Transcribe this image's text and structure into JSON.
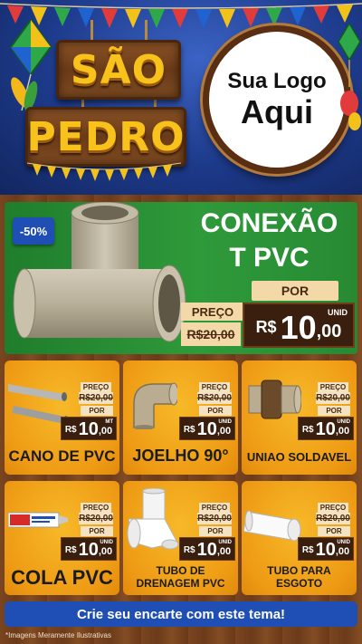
{
  "header": {
    "title_line1": "SÃO",
    "title_line2": "PEDRO",
    "logo_line1": "Sua Logo",
    "logo_line2": "Aqui"
  },
  "hero": {
    "discount": "-50%",
    "title_line1": "CONEXÃO",
    "title_line2": "T PVC",
    "por_label": "POR",
    "preco_label": "PREÇO",
    "old_price": "R$20,00",
    "currency": "R$",
    "price_int": "10",
    "price_dec": ",00",
    "unit": "UNID"
  },
  "products": [
    {
      "name": "CANO DE PVC",
      "preco_label": "PREÇO",
      "old_price": "R$20,00",
      "por_label": "POR",
      "currency": "R$",
      "price_int": "10",
      "price_dec": ",00",
      "unit": "MT"
    },
    {
      "name": "JOELHO 90°",
      "preco_label": "PREÇO",
      "old_price": "R$20,00",
      "por_label": "POR",
      "currency": "R$",
      "price_int": "10",
      "price_dec": ",00",
      "unit": "UNID"
    },
    {
      "name": "UNIAO SOLDAVEL",
      "preco_label": "PREÇO",
      "old_price": "R$20,00",
      "por_label": "POR",
      "currency": "R$",
      "price_int": "10",
      "price_dec": ",00",
      "unit": "UNID"
    },
    {
      "name": "COLA PVC",
      "preco_label": "PREÇO",
      "old_price": "R$20,00",
      "por_label": "POR",
      "currency": "R$",
      "price_int": "10",
      "price_dec": ",00",
      "unit": "UNID"
    },
    {
      "name_line1": "TUBO DE",
      "name_line2": "DRENAGEM PVC",
      "preco_label": "PREÇO",
      "old_price": "R$20,00",
      "por_label": "POR",
      "currency": "R$",
      "price_int": "10",
      "price_dec": ",00",
      "unit": "UNID"
    },
    {
      "name_line1": "TUBO PARA",
      "name_line2": "ESGOTO",
      "preco_label": "PREÇO",
      "old_price": "R$20,00",
      "por_label": "POR",
      "currency": "R$",
      "price_int": "10",
      "price_dec": ",00",
      "unit": "UNID"
    }
  ],
  "cta": "Crie seu encarte com este tema!",
  "footnote": "*Imagens Meramente Ilustrativas",
  "colors": {
    "hero_green": "#2f9a3a",
    "card_orange": "#f2a81d",
    "cta_blue": "#1f4fb5",
    "price_dark": "#3a1f0e",
    "title_yellow": "#f7c21c"
  }
}
